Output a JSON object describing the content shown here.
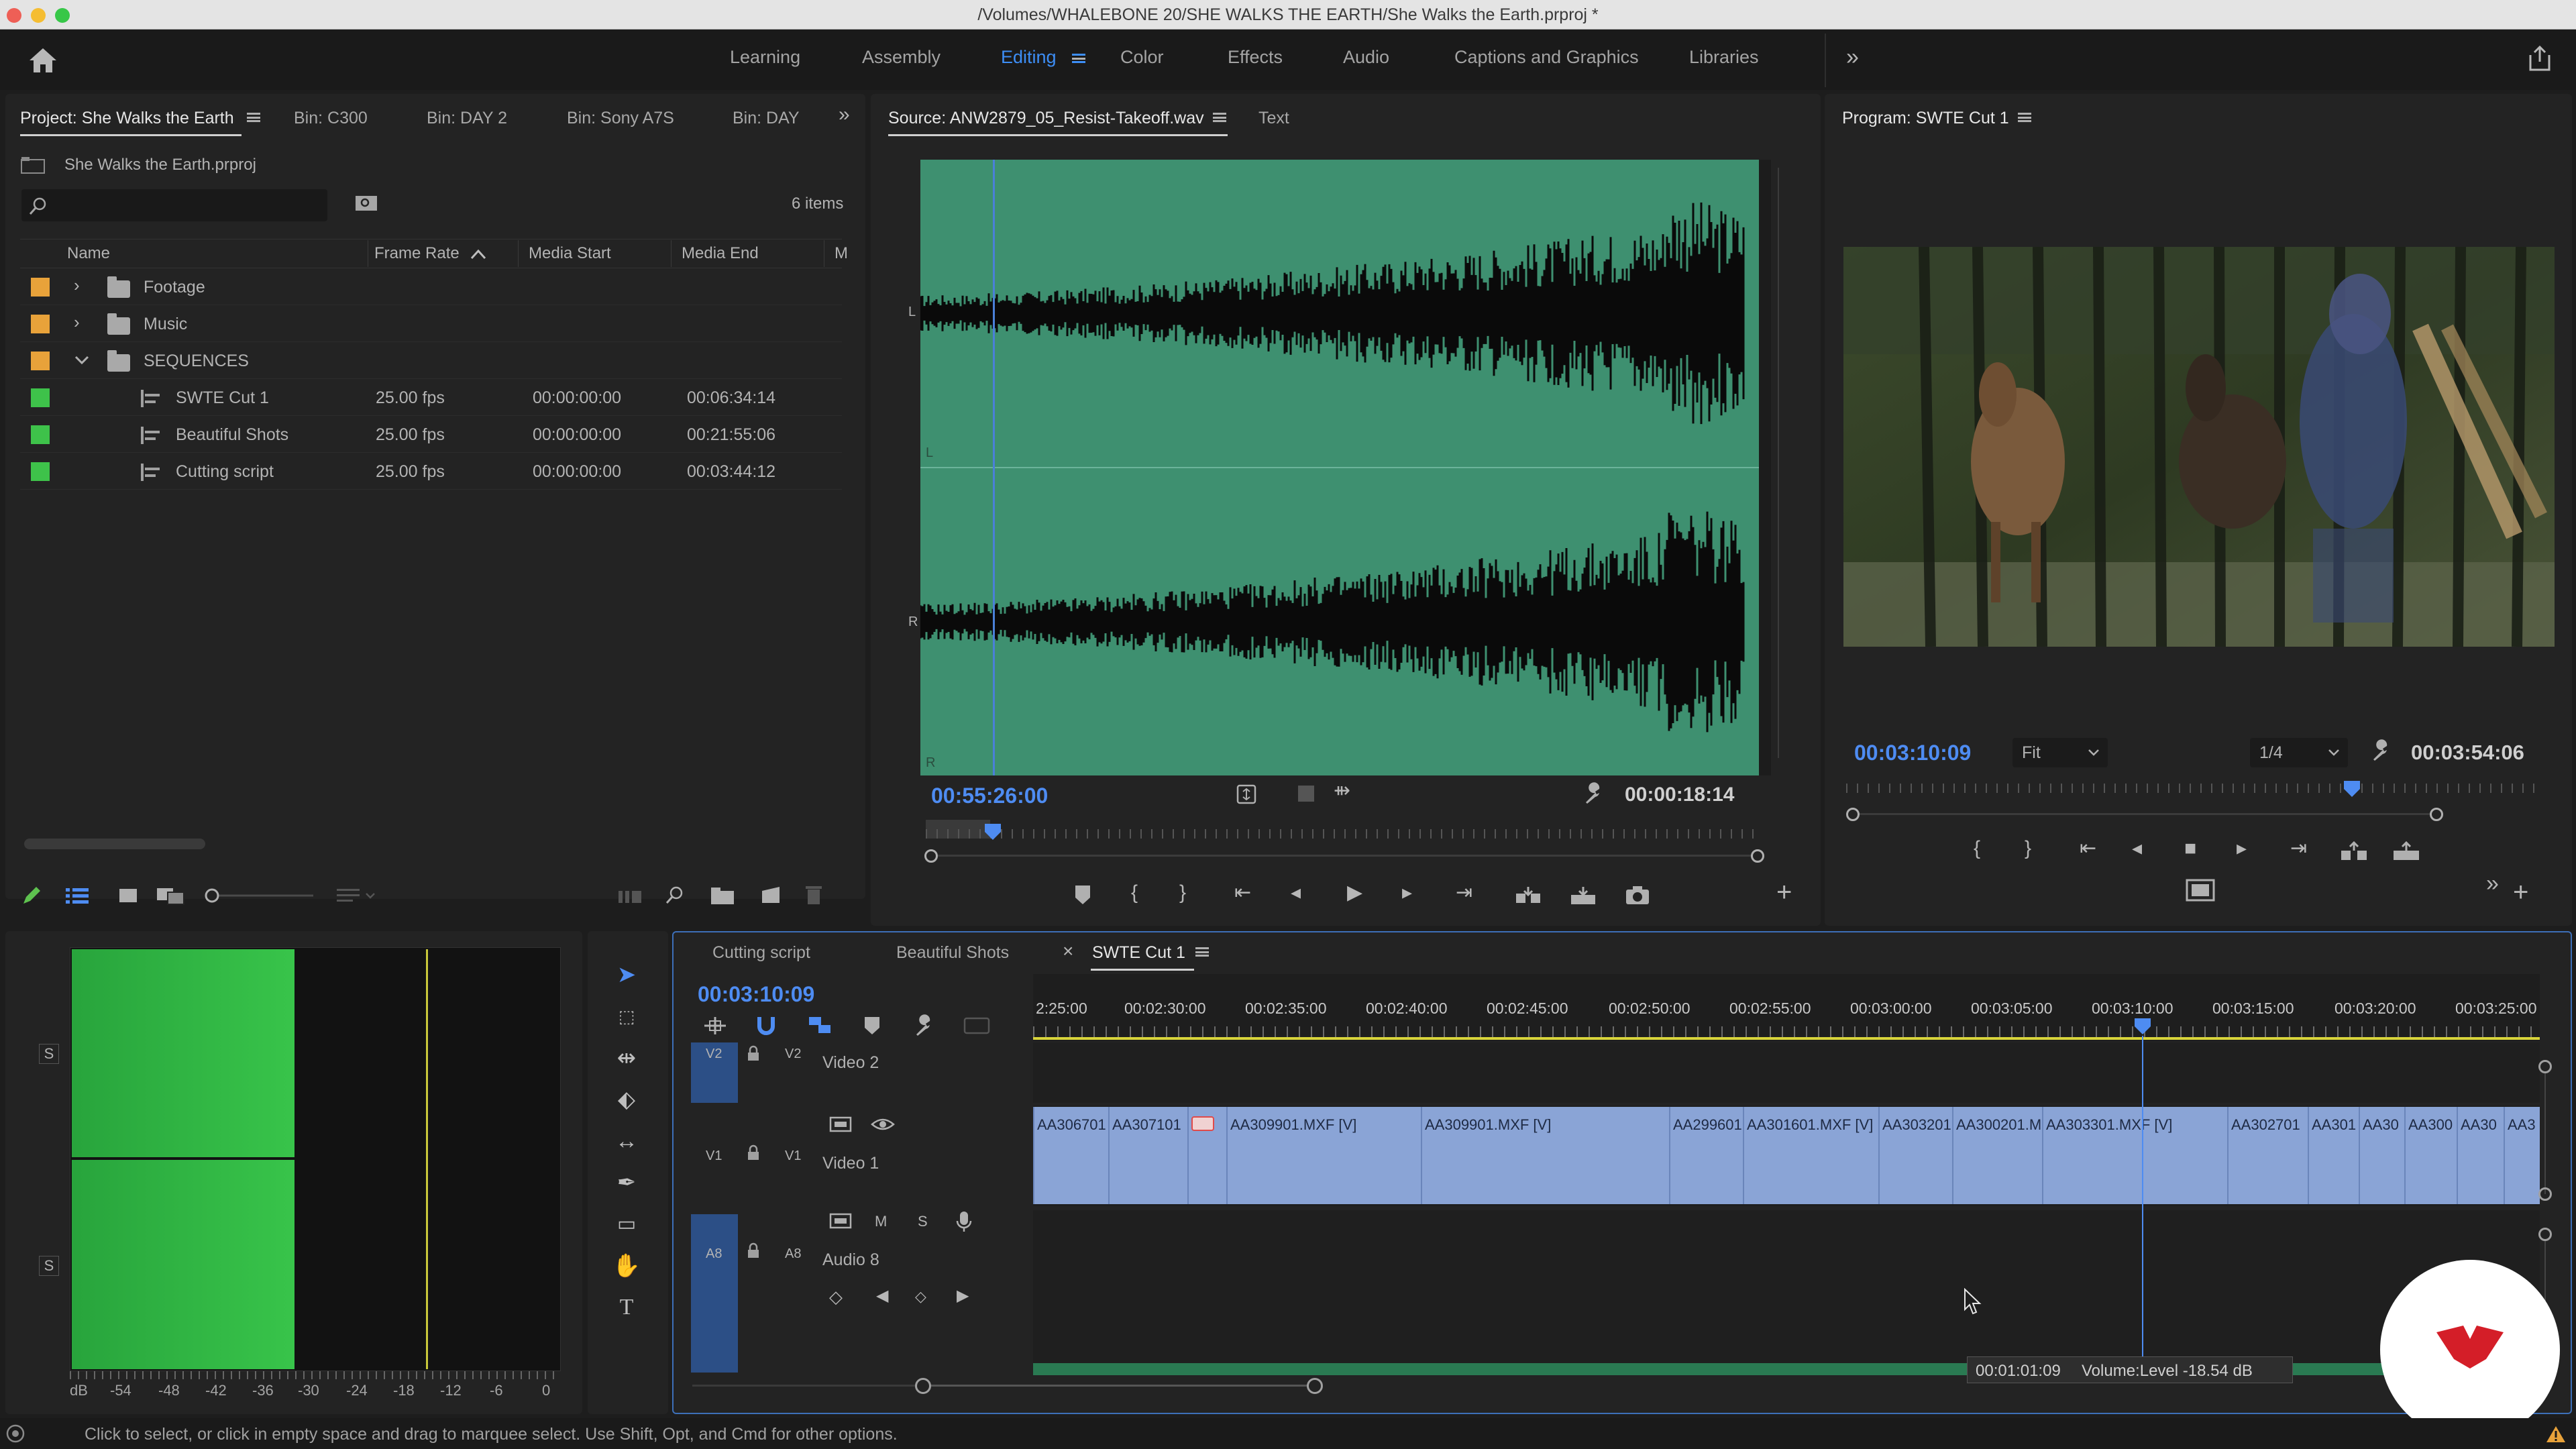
{
  "window": {
    "title": "/Volumes/WHALEBONE 20/SHE WALKS THE EARTH/She Walks the Earth.prproj *"
  },
  "workspaces": [
    {
      "label": "Learning",
      "active": false
    },
    {
      "label": "Assembly",
      "active": false
    },
    {
      "label": "Editing",
      "active": true
    },
    {
      "label": "Color",
      "active": false
    },
    {
      "label": "Effects",
      "active": false
    },
    {
      "label": "Audio",
      "active": false
    },
    {
      "label": "Captions and Graphics",
      "active": false
    },
    {
      "label": "Libraries",
      "active": false
    }
  ],
  "project": {
    "tabs": [
      "Project: She Walks the Earth",
      "Bin: C300",
      "Bin: DAY 2",
      "Bin: Sony A7S",
      "Bin: DAY"
    ],
    "file": "She Walks the Earth.prproj",
    "search_placeholder": "",
    "item_count": "6 items",
    "columns": [
      "Name",
      "Frame Rate",
      "Media Start",
      "Media End",
      "M"
    ],
    "folders": [
      {
        "name": "Footage",
        "expanded": false,
        "color": "#e8a23a"
      },
      {
        "name": "Music",
        "expanded": false,
        "color": "#e8a23a"
      },
      {
        "name": "SEQUENCES",
        "expanded": true,
        "color": "#e8a23a"
      }
    ],
    "sequences": [
      {
        "name": "SWTE Cut 1",
        "fps": "25.00 fps",
        "start": "00:00:00:00",
        "end": "00:06:34:14",
        "color": "#3ec24a"
      },
      {
        "name": "Beautiful Shots",
        "fps": "25.00 fps",
        "start": "00:00:00:00",
        "end": "00:21:55:06",
        "color": "#3ec24a"
      },
      {
        "name": "Cutting script",
        "fps": "25.00 fps",
        "start": "00:00:00:00",
        "end": "00:03:44:12",
        "color": "#3ec24a"
      }
    ]
  },
  "source": {
    "tab": "Source: ANW2879_05_Resist-Takeoff.wav",
    "tab2": "Text",
    "timecode": "00:55:26:00",
    "duration": "00:00:18:14",
    "channels": [
      "L",
      "L",
      "R",
      "R"
    ]
  },
  "program": {
    "tab": "Program: SWTE Cut 1",
    "timecode": "00:03:10:09",
    "fit": "Fit",
    "resolution": "1/4",
    "duration": "00:03:54:06"
  },
  "timeline": {
    "tabs": [
      "Cutting script",
      "Beautiful Shots",
      "SWTE Cut 1"
    ],
    "timecode": "00:03:10:09",
    "ruler": [
      "2:25:00",
      "00:02:30:00",
      "00:02:35:00",
      "00:02:40:00",
      "00:02:45:00",
      "00:02:50:00",
      "00:02:55:00",
      "00:03:00:00",
      "00:03:05:00",
      "00:03:10:00",
      "00:03:15:00",
      "00:03:20:00",
      "00:03:25:00"
    ],
    "tracks": {
      "v2": {
        "id": "V2",
        "label": "Video 2"
      },
      "v1": {
        "id": "V1",
        "label": "Video 1"
      },
      "a8": {
        "id": "A8",
        "label": "Audio 8",
        "buttons": [
          "M",
          "S"
        ]
      }
    },
    "clips": [
      "AA306701",
      "AA307101",
      "",
      "AA309901.MXF [V]",
      "AA309901.MXF [V]",
      "AA299601",
      "AA301601.MXF [V]",
      "AA303201",
      "AA300201.M",
      "AA303301.MXF [V]",
      "AA302701",
      "AA301",
      "AA30",
      "AA300",
      "AA30",
      "AA3"
    ],
    "tooltip": {
      "time": "00:01:01:09",
      "text": "Volume:Level  -18.54 dB"
    }
  },
  "meter": {
    "solo": "S",
    "scale": [
      "dB",
      "-54",
      "-48",
      "-42",
      "-36",
      "-30",
      "-24",
      "-18",
      "-12",
      "-6",
      "0"
    ]
  },
  "status": {
    "text": "Click to select, or click in empty space and drag to marquee select. Use Shift, Opt, and Cmd for other options."
  }
}
